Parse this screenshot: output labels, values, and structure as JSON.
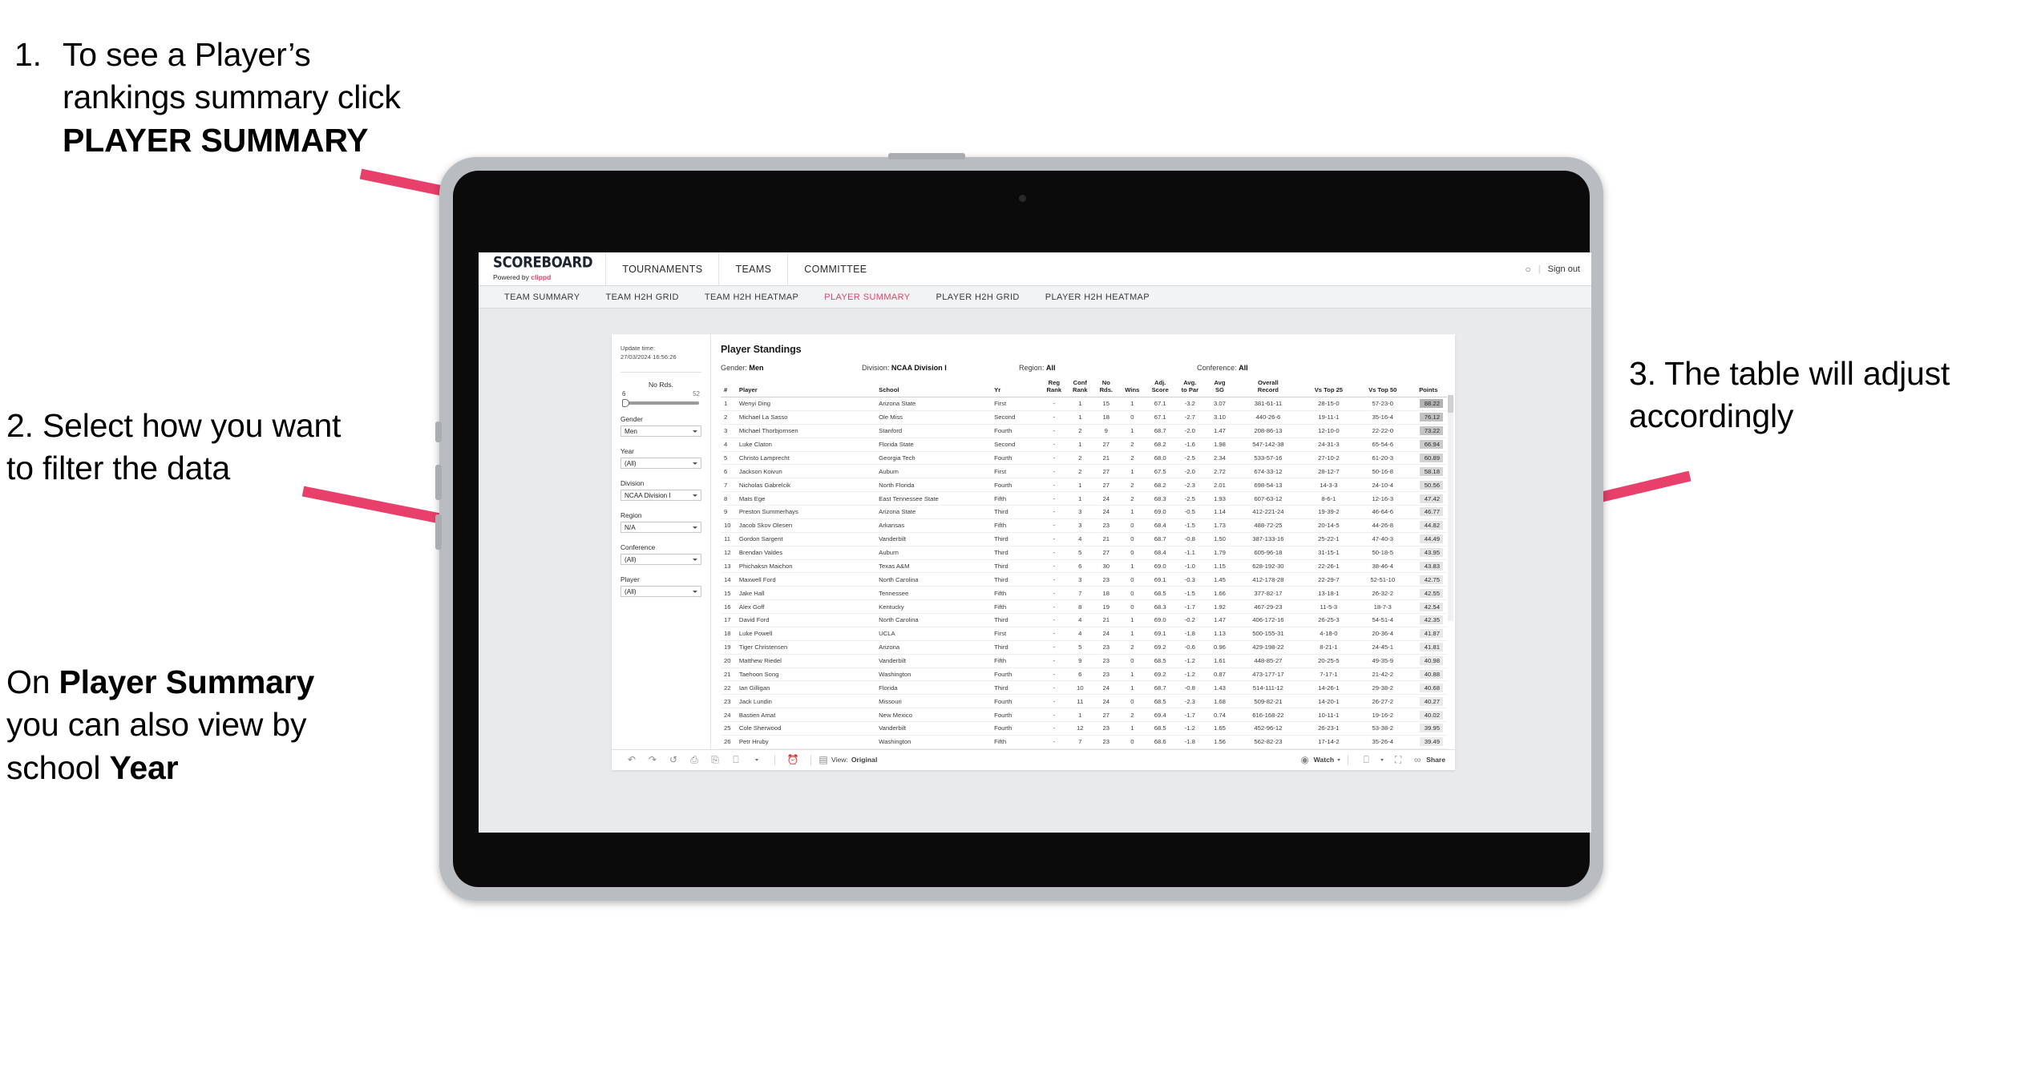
{
  "annotations": {
    "step1": {
      "number": "1.",
      "text_before": "To see a Player’s rankings summary click ",
      "bold": "PLAYER SUMMARY"
    },
    "step2": {
      "line": "2. Select how you want to filter the data"
    },
    "step2b": {
      "pre": "On ",
      "bold1": "Player Summary",
      "mid": " you can also view by school ",
      "bold2": "Year"
    },
    "step3": {
      "line": "3. The table will adjust accordingly"
    }
  },
  "app": {
    "brand": {
      "title": "SCOREBOARD",
      "powered_prefix": "Powered by ",
      "powered_brand": "clippd"
    },
    "top_nav": [
      "TOURNAMENTS",
      "TEAMS",
      "COMMITTEE"
    ],
    "header_right": {
      "avatar": "○",
      "separator": "|",
      "sign_out": "Sign out"
    },
    "sub_nav": [
      {
        "label": "TEAM SUMMARY",
        "active": false
      },
      {
        "label": "TEAM H2H GRID",
        "active": false
      },
      {
        "label": "TEAM H2H HEATMAP",
        "active": false
      },
      {
        "label": "PLAYER SUMMARY",
        "active": true
      },
      {
        "label": "PLAYER H2H GRID",
        "active": false
      },
      {
        "label": "PLAYER H2H HEATMAP",
        "active": false
      }
    ],
    "accent_color": "#e8406a"
  },
  "filters": {
    "update_label": "Update time:",
    "update_value": "27/03/2024 16:56:26",
    "slider": {
      "label": "No Rds.",
      "min": "6",
      "max": "52"
    },
    "selects": [
      {
        "label": "Gender",
        "value": "Men"
      },
      {
        "label": "Year",
        "value": "(All)"
      },
      {
        "label": "Division",
        "value": "NCAA Division I"
      },
      {
        "label": "Region",
        "value": "N/A"
      },
      {
        "label": "Conference",
        "value": "(All)"
      },
      {
        "label": "Player",
        "value": "(All)"
      }
    ]
  },
  "table": {
    "title": "Player Standings",
    "meta": [
      {
        "label": "Gender: ",
        "value": "Men"
      },
      {
        "label": "Division: ",
        "value": "NCAA Division I"
      },
      {
        "label": "Region: ",
        "value": "All"
      },
      {
        "label": "Conference: ",
        "value": "All"
      }
    ],
    "columns": [
      "#",
      "Player",
      "School",
      "Yr",
      "Reg Rank",
      "Conf Rank",
      "No Rds.",
      "Wins",
      "Adj. Score",
      "Avg. to Par",
      "Avg SG",
      "Overall Record",
      "Vs Top 25",
      "Vs Top 50",
      "Points"
    ],
    "columns_wrapped": [
      {
        "l1": "#",
        "l2": ""
      },
      {
        "l1": "Player",
        "l2": ""
      },
      {
        "l1": "School",
        "l2": ""
      },
      {
        "l1": "Yr",
        "l2": ""
      },
      {
        "l1": "Reg",
        "l2": "Rank"
      },
      {
        "l1": "Conf",
        "l2": "Rank"
      },
      {
        "l1": "No",
        "l2": "Rds."
      },
      {
        "l1": "Wins",
        "l2": ""
      },
      {
        "l1": "Adj.",
        "l2": "Score"
      },
      {
        "l1": "Avg.",
        "l2": "to Par"
      },
      {
        "l1": "Avg",
        "l2": "SG"
      },
      {
        "l1": "Overall",
        "l2": "Record"
      },
      {
        "l1": "Vs Top 25",
        "l2": ""
      },
      {
        "l1": "Vs Top 50",
        "l2": ""
      },
      {
        "l1": "Points",
        "l2": ""
      }
    ],
    "rows": [
      [
        "1",
        "Wenyi Ding",
        "Arizona State",
        "First",
        "-",
        "1",
        "15",
        "1",
        "67.1",
        "-3.2",
        "3.07",
        "381-61-11",
        "28-15-0",
        "57-23-0",
        "88.22"
      ],
      [
        "2",
        "Michael La Sasso",
        "Ole Miss",
        "Second",
        "-",
        "1",
        "18",
        "0",
        "67.1",
        "-2.7",
        "3.10",
        "440-26-6",
        "19-11-1",
        "35-16-4",
        "76.12"
      ],
      [
        "3",
        "Michael Thorbjornsen",
        "Stanford",
        "Fourth",
        "-",
        "2",
        "9",
        "1",
        "68.7",
        "-2.0",
        "1.47",
        "208-86-13",
        "12-10-0",
        "22-22-0",
        "73.22"
      ],
      [
        "4",
        "Luke Claton",
        "Florida State",
        "Second",
        "-",
        "1",
        "27",
        "2",
        "68.2",
        "-1.6",
        "1.98",
        "547-142-38",
        "24-31-3",
        "65-54-6",
        "66.94"
      ],
      [
        "5",
        "Christo Lamprecht",
        "Georgia Tech",
        "Fourth",
        "-",
        "2",
        "21",
        "2",
        "68.0",
        "-2.5",
        "2.34",
        "533-57-16",
        "27-10-2",
        "61-20-3",
        "60.89"
      ],
      [
        "6",
        "Jackson Koivun",
        "Auburn",
        "First",
        "-",
        "2",
        "27",
        "1",
        "67.5",
        "-2.0",
        "2.72",
        "674-33-12",
        "28-12-7",
        "50-16-8",
        "58.18"
      ],
      [
        "7",
        "Nicholas Gabrelcik",
        "North Florida",
        "Fourth",
        "-",
        "1",
        "27",
        "2",
        "68.2",
        "-2.3",
        "2.01",
        "698-54-13",
        "14-3-3",
        "24-10-4",
        "50.56"
      ],
      [
        "8",
        "Mats Ege",
        "East Tennessee State",
        "Fifth",
        "-",
        "1",
        "24",
        "2",
        "68.3",
        "-2.5",
        "1.93",
        "607-63-12",
        "8-6-1",
        "12-16-3",
        "47.42"
      ],
      [
        "9",
        "Preston Summerhays",
        "Arizona State",
        "Third",
        "-",
        "3",
        "24",
        "1",
        "69.0",
        "-0.5",
        "1.14",
        "412-221-24",
        "19-39-2",
        "46-64-6",
        "46.77"
      ],
      [
        "10",
        "Jacob Skov Olesen",
        "Arkansas",
        "Fifth",
        "-",
        "3",
        "23",
        "0",
        "68.4",
        "-1.5",
        "1.73",
        "488-72-25",
        "20-14-5",
        "44-26-8",
        "44.82"
      ],
      [
        "11",
        "Gordon Sargent",
        "Vanderbilt",
        "Third",
        "-",
        "4",
        "21",
        "0",
        "68.7",
        "-0.8",
        "1.50",
        "387-133-16",
        "25-22-1",
        "47-40-3",
        "44.49"
      ],
      [
        "12",
        "Brendan Valdes",
        "Auburn",
        "Third",
        "-",
        "5",
        "27",
        "0",
        "68.4",
        "-1.1",
        "1.79",
        "605-96-18",
        "31-15-1",
        "50-18-5",
        "43.95"
      ],
      [
        "13",
        "Phichaksn Maichon",
        "Texas A&M",
        "Third",
        "-",
        "6",
        "30",
        "1",
        "69.0",
        "-1.0",
        "1.15",
        "628-192-30",
        "22-26-1",
        "38-46-4",
        "43.83"
      ],
      [
        "14",
        "Maxwell Ford",
        "North Carolina",
        "Third",
        "-",
        "3",
        "23",
        "0",
        "69.1",
        "-0.3",
        "1.45",
        "412-178-28",
        "22-29-7",
        "52-51-10",
        "42.75"
      ],
      [
        "15",
        "Jake Hall",
        "Tennessee",
        "Fifth",
        "-",
        "7",
        "18",
        "0",
        "68.5",
        "-1.5",
        "1.66",
        "377-82-17",
        "13-18-1",
        "26-32-2",
        "42.55"
      ],
      [
        "16",
        "Alex Goff",
        "Kentucky",
        "Fifth",
        "-",
        "8",
        "19",
        "0",
        "68.3",
        "-1.7",
        "1.92",
        "467-29-23",
        "11-5-3",
        "18-7-3",
        "42.54"
      ],
      [
        "17",
        "David Ford",
        "North Carolina",
        "Third",
        "-",
        "4",
        "21",
        "1",
        "69.0",
        "-0.2",
        "1.47",
        "406-172-16",
        "26-25-3",
        "54-51-4",
        "42.35"
      ],
      [
        "18",
        "Luke Powell",
        "UCLA",
        "First",
        "-",
        "4",
        "24",
        "1",
        "69.1",
        "-1.8",
        "1.13",
        "500-155-31",
        "4-18-0",
        "20-36-4",
        "41.87"
      ],
      [
        "19",
        "Tiger Christensen",
        "Arizona",
        "Third",
        "-",
        "5",
        "23",
        "2",
        "69.2",
        "-0.6",
        "0.96",
        "429-198-22",
        "8-21-1",
        "24-45-1",
        "41.81"
      ],
      [
        "20",
        "Matthew Riedel",
        "Vanderbilt",
        "Fifth",
        "-",
        "9",
        "23",
        "0",
        "68.5",
        "-1.2",
        "1.61",
        "448-85-27",
        "20-25-5",
        "49-35-9",
        "40.98"
      ],
      [
        "21",
        "Taehoon Song",
        "Washington",
        "Fourth",
        "-",
        "6",
        "23",
        "1",
        "69.2",
        "-1.2",
        "0.87",
        "473-177-17",
        "7-17-1",
        "21-42-2",
        "40.88"
      ],
      [
        "22",
        "Ian Gilligan",
        "Florida",
        "Third",
        "-",
        "10",
        "24",
        "1",
        "68.7",
        "-0.8",
        "1.43",
        "514-111-12",
        "14-26-1",
        "29-38-2",
        "40.68"
      ],
      [
        "23",
        "Jack Lundin",
        "Missouri",
        "Fourth",
        "-",
        "11",
        "24",
        "0",
        "68.5",
        "-2.3",
        "1.68",
        "509-82-21",
        "14-20-1",
        "26-27-2",
        "40.27"
      ],
      [
        "24",
        "Bastien Amat",
        "New Mexico",
        "Fourth",
        "-",
        "1",
        "27",
        "2",
        "69.4",
        "-1.7",
        "0.74",
        "616-168-22",
        "10-11-1",
        "19-16-2",
        "40.02"
      ],
      [
        "25",
        "Cole Sherwood",
        "Vanderbilt",
        "Fourth",
        "-",
        "12",
        "23",
        "1",
        "68.5",
        "-1.2",
        "1.65",
        "452-96-12",
        "26-23-1",
        "53-38-2",
        "39.95"
      ],
      [
        "26",
        "Petr Hruby",
        "Washington",
        "Fifth",
        "-",
        "7",
        "23",
        "0",
        "68.6",
        "-1.8",
        "1.56",
        "562-82-23",
        "17-14-2",
        "35-26-4",
        "39.49"
      ]
    ]
  },
  "toolbar": {
    "icons": [
      "undo-icon",
      "redo-icon",
      "revert-icon",
      "refresh-data-icon",
      "pause-icon",
      "device-layout-icon"
    ],
    "view_label": "View: ",
    "view_value": "Original",
    "watch_label": "Watch",
    "share_label": "Share"
  }
}
